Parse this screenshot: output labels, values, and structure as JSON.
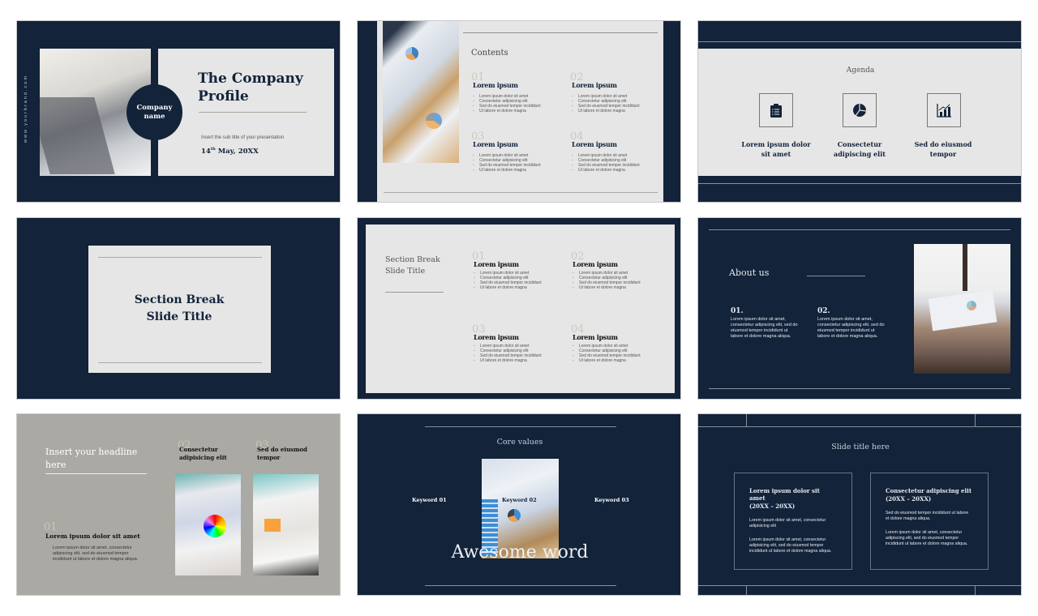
{
  "colors": {
    "navy": "#12233a",
    "light_panel": "#e6e6e6",
    "taupe": "#aba9a3",
    "number_beige": "#cfc8bb"
  },
  "bullets": [
    "Lorem ipsum dolor sit amet",
    "Consectetur adipisicing elit",
    "Sed do eiusmod tempor incididunt",
    "Ut labore et dolore magna"
  ],
  "slide1": {
    "website": "www.yourbrand.com",
    "circle_label": "Company name",
    "title": "The Company Profile",
    "subtitle": "Insert the sub title of your presentation",
    "date_day": "14",
    "date_sup": "th",
    "date_rest": " May, 20XX"
  },
  "slide2": {
    "title": "Contents",
    "sections": [
      {
        "num": "01",
        "heading": "Lorem ipsum"
      },
      {
        "num": "02",
        "heading": "Lorem ipsum"
      },
      {
        "num": "03",
        "heading": "Lorem ipsum"
      },
      {
        "num": "04",
        "heading": "Lorem ipsum"
      }
    ]
  },
  "slide3": {
    "title": "Agenda",
    "items": [
      {
        "icon": "clipboard-icon",
        "label": "Lorem ipsum dolor sit amet"
      },
      {
        "icon": "pie-chart-icon",
        "label": "Consectetur adipiscing elit"
      },
      {
        "icon": "bar-chart-growth-icon",
        "label": "Sed do eiusmod tempor"
      }
    ]
  },
  "slide4": {
    "title": "Section Break Slide Title"
  },
  "slide5": {
    "title": "Section Break Slide Title",
    "sections": [
      {
        "num": "01",
        "heading": "Lorem ipsum"
      },
      {
        "num": "02",
        "heading": "Lorem ipsum"
      },
      {
        "num": "03",
        "heading": "Lorem ipsum"
      },
      {
        "num": "04",
        "heading": "Lorem ipsum"
      }
    ]
  },
  "slide6": {
    "title": "About us",
    "points": [
      {
        "num": "01.",
        "text": "Lorem ipsum dolor sit amet, consectetur adipiscing elit, sed do eiusmod tempor incididunt ut labore et dolore magna aliqua."
      },
      {
        "num": "02.",
        "text": "Lorem ipsum dolor sit amet, consectetur adipiscing elit, sed do eiusmod tempor incididunt ut labore et dolore magna aliqua."
      }
    ]
  },
  "slide7": {
    "headline": "Insert your headline here",
    "item1": {
      "num": "01",
      "heading": "Lorem ipsum dolor sit amet",
      "text": "Lorem ipsum dolor sit amet, consectetur adipiscing elit, sed do eiusmod tempor incididunt ut labore et dolore magna aliqua."
    },
    "item2": {
      "num": "02",
      "heading": "Consectetur adipisicing elit"
    },
    "item3": {
      "num": "03",
      "heading": "Sed do eiusmod tempor"
    }
  },
  "slide8": {
    "title": "Core values",
    "keyword1": "Keyword 01",
    "keyword2": "Keyword 02",
    "keyword3": "Keyword 03",
    "big_word": "Awesome word"
  },
  "slide9": {
    "title": "Slide title here",
    "boxes": [
      {
        "heading": "Lorem ipsum dolor sit amet",
        "years": "(20XX – 20XX)",
        "p1": "Lorem ipsum dolor sit amet, consectetur adipisicing elit",
        "p2": "Lorem ipsum dolor sit amet, consectetur adipisicing elit, sed do eiusmod tempor incididunt ut labore et dolore magna aliqua."
      },
      {
        "heading": "Consectetur adipiscing elit",
        "years": "(20XX – 20XX)",
        "p1": "Sed do eiusmod tempor incididunt ut labore et dolore magna aliqua.",
        "p2": "Lorem ipsum dolor sit amet, consectetur adipiscing elit, sed do eiusmod tempor incididunt ut labore et dolore magna aliqua."
      }
    ]
  }
}
